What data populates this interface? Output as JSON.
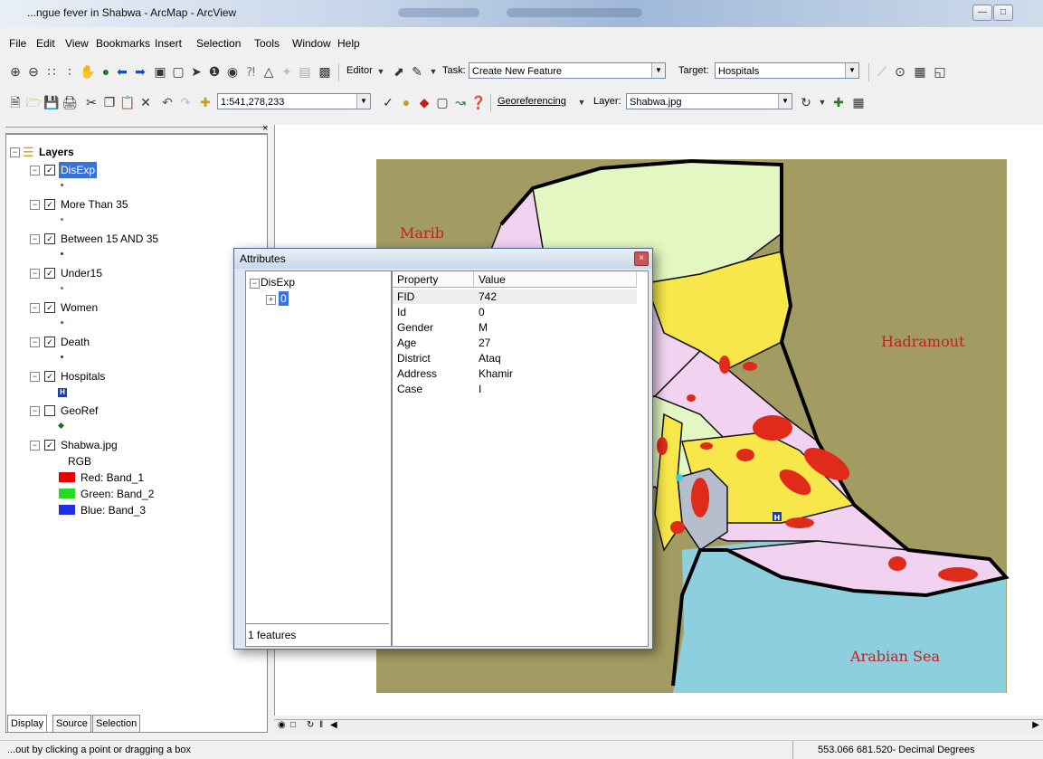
{
  "window": {
    "title": "...ngue fever in Shabwa - ArcMap - ArcView",
    "controls": [
      "minimize-icon",
      "maximize-icon"
    ]
  },
  "menu": [
    "File",
    "Edit",
    "View",
    "Bookmarks",
    "Insert",
    "Selection",
    "Tools",
    "Window",
    "Help"
  ],
  "editor_toolbar": {
    "editor_label": "Editor",
    "task_label": "Task:",
    "task_value": "Create New Feature",
    "target_label": "Target:",
    "target_value": "Hospitals"
  },
  "standard_toolbar": {
    "scale_value": "1:541,278,233",
    "georeferencing_label": "Georeferencing",
    "layer_label": "Layer:",
    "layer_value": "Shabwa.jpg"
  },
  "toc": {
    "root_label": "Layers",
    "layers": [
      {
        "label": "DisExp",
        "checked": true,
        "selected": true,
        "symbol": "dot-red"
      },
      {
        "label": "More Than 35",
        "checked": true,
        "symbol": "dot-green"
      },
      {
        "label": "Between 15 AND 35",
        "checked": true,
        "symbol": "dot-dark"
      },
      {
        "label": "Under15",
        "checked": true,
        "symbol": "dot-green"
      },
      {
        "label": "Women",
        "checked": true,
        "symbol": "dot-red"
      },
      {
        "label": "Death",
        "checked": true,
        "symbol": "dot-dark"
      },
      {
        "label": "Hospitals",
        "checked": true,
        "symbol": "hospital-icon",
        "symbol_text": "H"
      },
      {
        "label": "GeoRef",
        "checked": false,
        "symbol": "diamond-green"
      },
      {
        "label": "Shabwa.jpg",
        "checked": true,
        "symbol": "raster"
      }
    ],
    "raster": {
      "type_label": "RGB",
      "bands": [
        {
          "label": "Red:  Band_1",
          "color": "#e60000"
        },
        {
          "label": "Green: Band_2",
          "color": "#22dd22"
        },
        {
          "label": "Blue:  Band_3",
          "color": "#1e2ee0"
        }
      ]
    },
    "tabs": [
      "Display",
      "Source",
      "Selection"
    ]
  },
  "map": {
    "labels": {
      "marib": "Marib",
      "hadramout": "Hadramout",
      "arabian_sea": "Arabian Sea"
    },
    "hospital_symbol": "H",
    "colors": {
      "background": "#a39c62",
      "sea": "#8ecfdf",
      "pink": "#f1d3f1",
      "yellow": "#f7e74a",
      "lightgreen": "#e2f7c1",
      "grey": "#b6bdcc",
      "dot": "#e02a1a"
    }
  },
  "attributes_dialog": {
    "title": "Attributes",
    "tree_root": "DisExp",
    "tree_child": "0",
    "feature_count": "1 features",
    "columns": [
      "Property",
      "Value"
    ],
    "rows": [
      {
        "property": "FID",
        "value": "742"
      },
      {
        "property": "Id",
        "value": "0"
      },
      {
        "property": "Gender",
        "value": "M"
      },
      {
        "property": "Age",
        "value": "27"
      },
      {
        "property": "District",
        "value": "Ataq"
      },
      {
        "property": "Address",
        "value": "Khamir"
      },
      {
        "property": "Case",
        "value": "I"
      }
    ]
  },
  "status_bar": {
    "message": "...out by clicking a point or dragging a box",
    "coordinates": "553.066  681.520- Decimal Degrees"
  }
}
